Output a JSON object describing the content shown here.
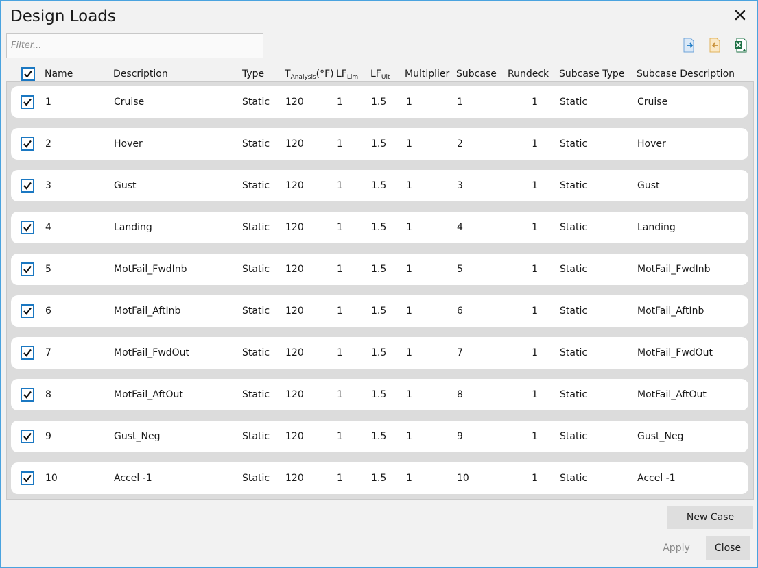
{
  "window": {
    "title": "Design Loads"
  },
  "filter": {
    "placeholder": "Filter...",
    "value": ""
  },
  "toolbar": {
    "icons": [
      "import-icon",
      "export-icon",
      "excel-icon"
    ]
  },
  "columns": {
    "name": "Name",
    "description": "Description",
    "type": "Type",
    "t_analysis": {
      "main": "T",
      "sub": "Analysis",
      "suffix": "(°F)"
    },
    "lf_lim": {
      "main": "LF",
      "sub": "Lim"
    },
    "lf_ult": {
      "main": "LF",
      "sub": "Ult"
    },
    "multiplier": "Multiplier",
    "subcase": "Subcase",
    "rundeck": "Rundeck",
    "subcase_type": "Subcase Type",
    "subcase_description": "Subcase Description"
  },
  "rows": [
    {
      "checked": true,
      "name": "1",
      "description": "Cruise",
      "type": "Static",
      "t_analysis": "120",
      "lf_lim": "1",
      "lf_ult": "1.5",
      "multiplier": "1",
      "subcase": "1",
      "rundeck": "1",
      "subcase_type": "Static",
      "subcase_description": "Cruise"
    },
    {
      "checked": true,
      "name": "2",
      "description": "Hover",
      "type": "Static",
      "t_analysis": "120",
      "lf_lim": "1",
      "lf_ult": "1.5",
      "multiplier": "1",
      "subcase": "2",
      "rundeck": "1",
      "subcase_type": "Static",
      "subcase_description": "Hover"
    },
    {
      "checked": true,
      "name": "3",
      "description": "Gust",
      "type": "Static",
      "t_analysis": "120",
      "lf_lim": "1",
      "lf_ult": "1.5",
      "multiplier": "1",
      "subcase": "3",
      "rundeck": "1",
      "subcase_type": "Static",
      "subcase_description": "Gust"
    },
    {
      "checked": true,
      "name": "4",
      "description": "Landing",
      "type": "Static",
      "t_analysis": "120",
      "lf_lim": "1",
      "lf_ult": "1.5",
      "multiplier": "1",
      "subcase": "4",
      "rundeck": "1",
      "subcase_type": "Static",
      "subcase_description": "Landing"
    },
    {
      "checked": true,
      "name": "5",
      "description": "MotFail_FwdInb",
      "type": "Static",
      "t_analysis": "120",
      "lf_lim": "1",
      "lf_ult": "1.5",
      "multiplier": "1",
      "subcase": "5",
      "rundeck": "1",
      "subcase_type": "Static",
      "subcase_description": "MotFail_FwdInb"
    },
    {
      "checked": true,
      "name": "6",
      "description": "MotFail_AftInb",
      "type": "Static",
      "t_analysis": "120",
      "lf_lim": "1",
      "lf_ult": "1.5",
      "multiplier": "1",
      "subcase": "6",
      "rundeck": "1",
      "subcase_type": "Static",
      "subcase_description": "MotFail_AftInb"
    },
    {
      "checked": true,
      "name": "7",
      "description": "MotFail_FwdOut",
      "type": "Static",
      "t_analysis": "120",
      "lf_lim": "1",
      "lf_ult": "1.5",
      "multiplier": "1",
      "subcase": "7",
      "rundeck": "1",
      "subcase_type": "Static",
      "subcase_description": "MotFail_FwdOut"
    },
    {
      "checked": true,
      "name": "8",
      "description": "MotFail_AftOut",
      "type": "Static",
      "t_analysis": "120",
      "lf_lim": "1",
      "lf_ult": "1.5",
      "multiplier": "1",
      "subcase": "8",
      "rundeck": "1",
      "subcase_type": "Static",
      "subcase_description": "MotFail_AftOut"
    },
    {
      "checked": true,
      "name": "9",
      "description": "Gust_Neg",
      "type": "Static",
      "t_analysis": "120",
      "lf_lim": "1",
      "lf_ult": "1.5",
      "multiplier": "1",
      "subcase": "9",
      "rundeck": "1",
      "subcase_type": "Static",
      "subcase_description": "Gust_Neg"
    },
    {
      "checked": true,
      "name": "10",
      "description": "Accel -1",
      "type": "Static",
      "t_analysis": "120",
      "lf_lim": "1",
      "lf_ult": "1.5",
      "multiplier": "1",
      "subcase": "10",
      "rundeck": "1",
      "subcase_type": "Static",
      "subcase_description": "Accel -1"
    }
  ],
  "buttons": {
    "new_case": "New Case",
    "apply": "Apply",
    "close": "Close"
  },
  "colors": {
    "accent": "#1b78c2",
    "window_border": "#4aa3df",
    "excel_green": "#1e7145"
  }
}
